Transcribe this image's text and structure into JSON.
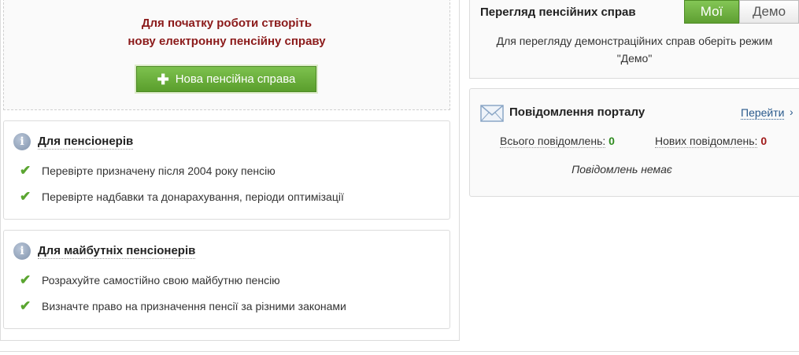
{
  "start": {
    "line1": "Для початку роботи створіть",
    "line2": "нову електронну пенсійну справу",
    "new_case_label": "Нова пенсійна справа"
  },
  "pensioners": {
    "title": "Для пенсіонерів",
    "items": [
      "Перевірте призначену після 2004 року пенсію",
      "Перевірте надбавки та донарахування, періоди оптимізації"
    ]
  },
  "future_pensioners": {
    "title": "Для майбутніх пенсіонерів",
    "items": [
      "Розрахуйте самостійно свою майбутню пенсію",
      "Визначте право на призначення пенсії за різними законами"
    ]
  },
  "view_cases": {
    "title": "Перегляд пенсійних справ",
    "mine_label": "Мої",
    "demo_label": "Демо",
    "selected": "Мої",
    "note": "Для перегляду демонстраційних справ оберіть режим \"Демо\""
  },
  "messages": {
    "title": "Повідомлення порталу",
    "go_label": "Перейти",
    "total_label": "Всього повідомлень:",
    "total_value": "0",
    "new_label": "Нових повідомлень:",
    "new_value": "0",
    "empty_text": "Повідомлень немає"
  },
  "colors": {
    "accent_green": "#5a9e2c",
    "heading_red": "#8b1a1a",
    "link_blue": "#2a5a8c"
  }
}
